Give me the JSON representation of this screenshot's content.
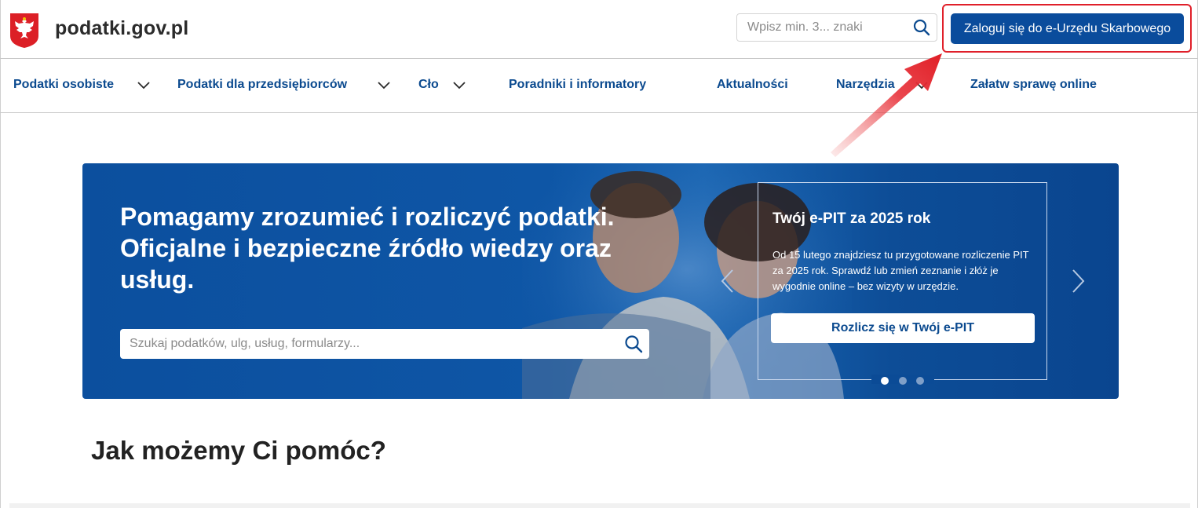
{
  "header": {
    "site_name": "podatki.gov.pl",
    "search_placeholder": "Wpisz min. 3... znaki",
    "login_label": "Zaloguj się do e-Urzędu Skarbowego"
  },
  "nav": {
    "items": [
      {
        "label": "Podatki osobiste"
      },
      {
        "label": "Podatki dla przedsiębiorców"
      },
      {
        "label": "Cło"
      },
      {
        "label": "Poradniki i informatory"
      },
      {
        "label": "Aktualności"
      },
      {
        "label": "Narzędzia"
      },
      {
        "label": "Załatw sprawę online"
      }
    ]
  },
  "hero": {
    "headline": "Pomagamy zrozumieć i rozliczyć podatki. Oficjalne i bezpieczne źródło wiedzy oraz usług.",
    "search_placeholder": "Szukaj podatków, ulg, usług, formularzy...",
    "card": {
      "title": "Twój e-PIT za 2025 rok",
      "text": "Od 15 lutego znajdziesz tu przygotowane rozliczenie PIT za 2025 rok. Sprawdź lub zmień zeznanie i złóż je wygodnie online – bez wizyty w urzędzie.",
      "button_label": "Rozlicz się w Twój e-PIT"
    },
    "carousel_total": 3,
    "carousel_active": 1
  },
  "help_heading": "Jak możemy Ci pomóc?",
  "colors": {
    "brand_blue": "#0a4c9c",
    "nav_text": "#0b4a8f",
    "highlight_red": "#e0202a"
  },
  "icons": {
    "emblem": "polish-eagle-emblem-icon",
    "search": "search-icon",
    "chevron": "chevron-down-icon",
    "prev": "chevron-left-icon",
    "next": "chevron-right-icon",
    "annotation": "red-arrow-icon"
  }
}
